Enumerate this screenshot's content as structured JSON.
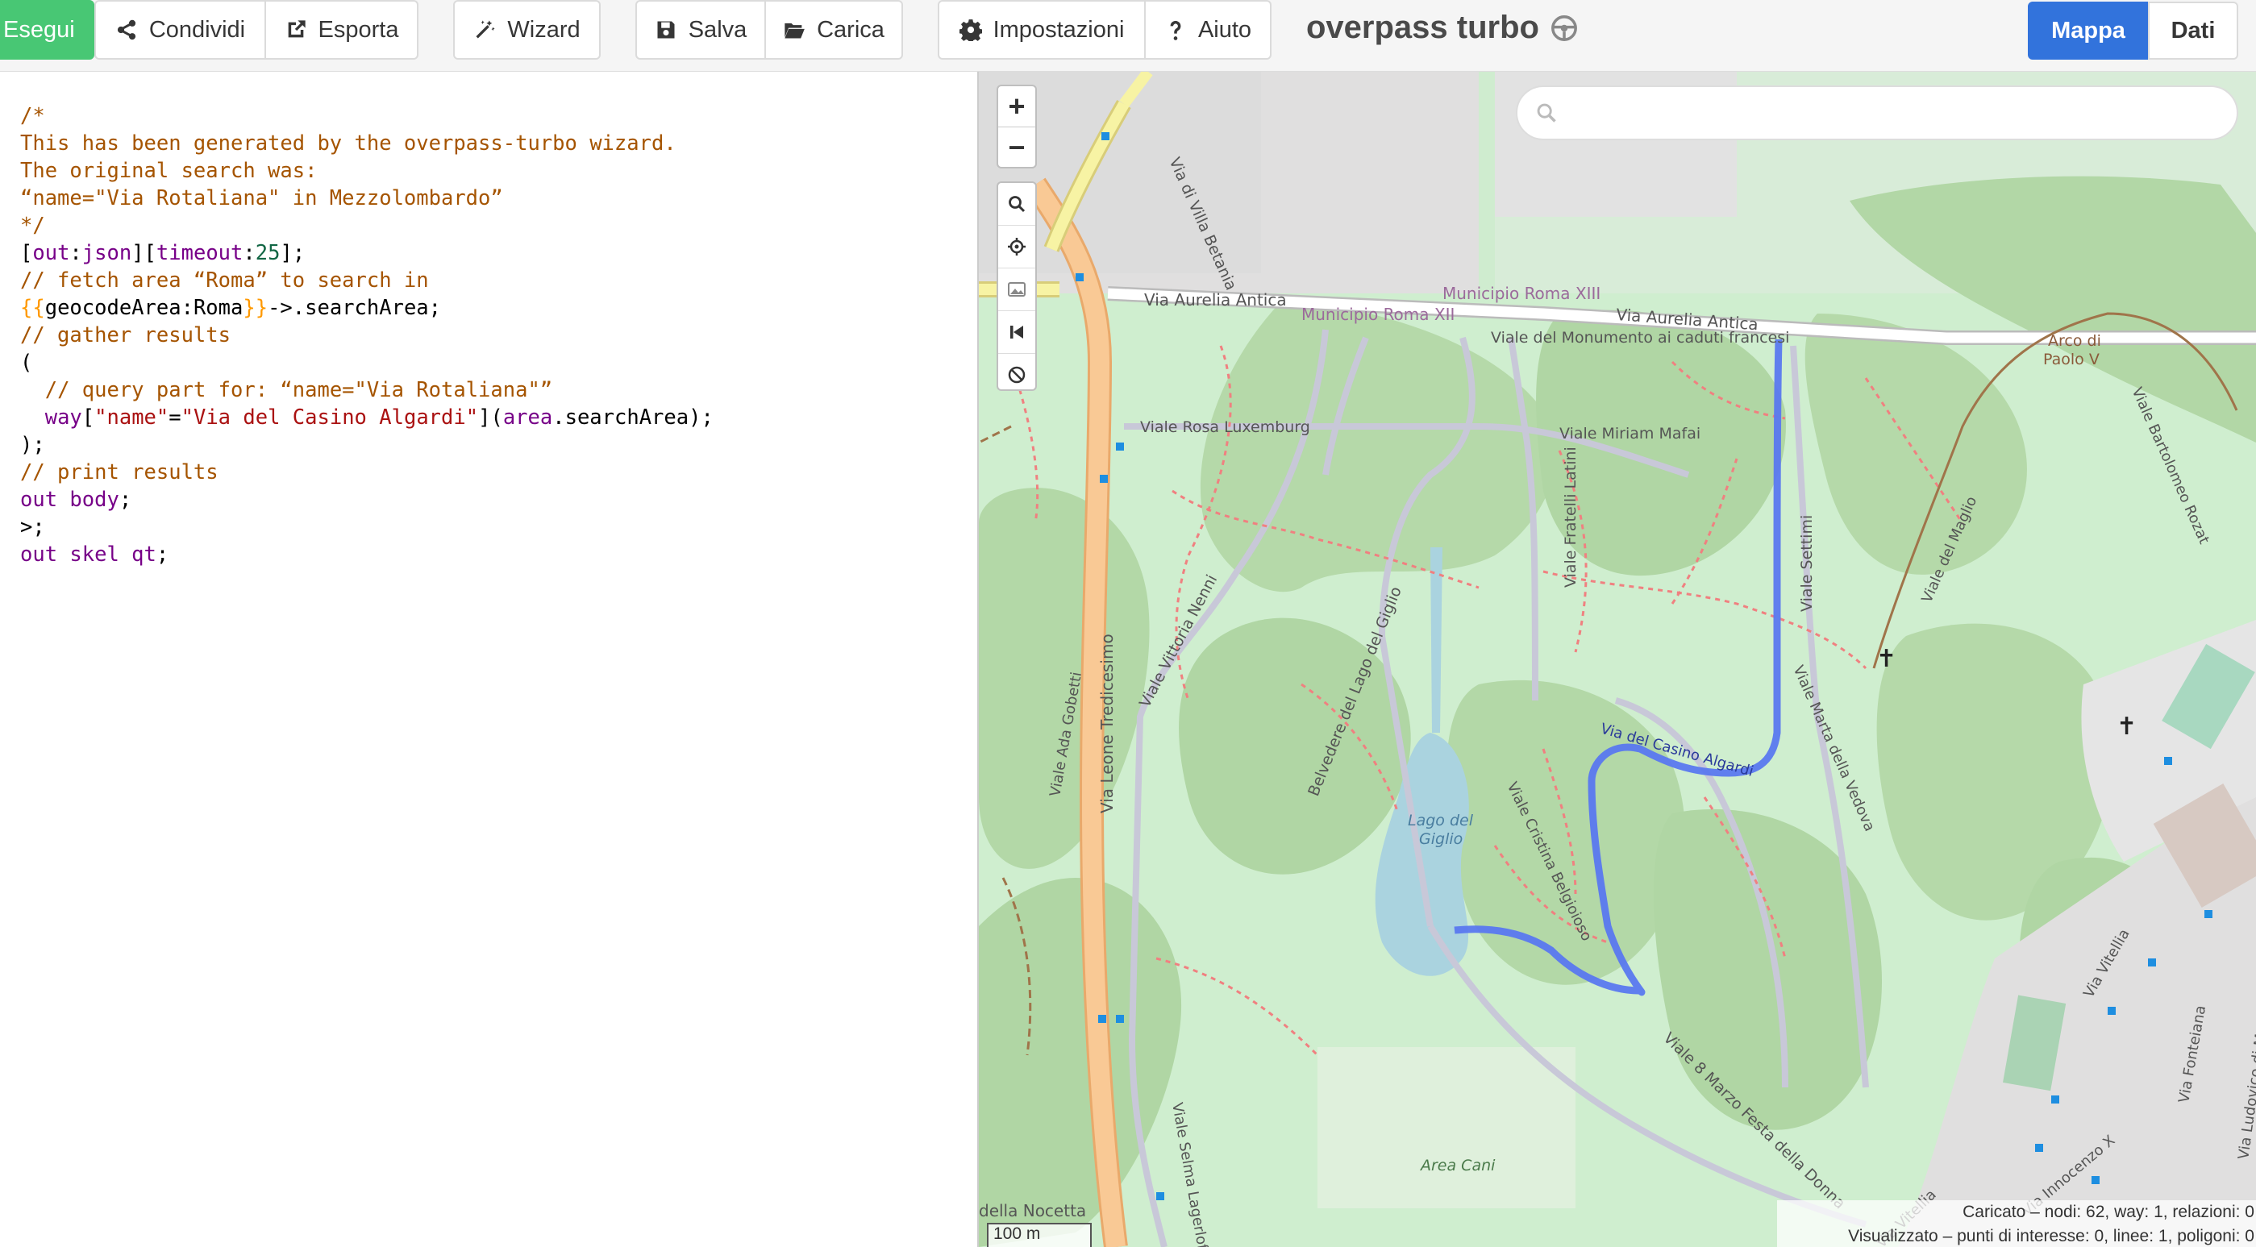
{
  "toolbar": {
    "run": "Esegui",
    "share": "Condividi",
    "export": "Esporta",
    "wizard": "Wizard",
    "save": "Salva",
    "load": "Carica",
    "settings": "Impostazioni",
    "help": "Aiuto",
    "app_title": "overpass turbo",
    "map_tab": "Mappa",
    "data_tab": "Dati"
  },
  "editor": {
    "lines": {
      "l1": "/*",
      "l2": "This has been generated by the overpass-turbo wizard.",
      "l3": "The original search was:",
      "l4": "“name=\"Via Rotaliana\" in Mezzolombardo”",
      "l5": "*/",
      "l6_kw1": "out",
      "l6_kw2": "json",
      "l6_kw3": "timeout",
      "l6_num": "25",
      "l7": "// fetch area “Roma” to search in",
      "l8_tpl_open": "{{",
      "l8_mid": "geocodeArea:Roma",
      "l8_tpl_close": "}}",
      "l8_rest": "->.searchArea;",
      "l9": "// gather results",
      "l11": "// query part for: “name=\"Via Rotaliana\"”",
      "l12_kw": "way",
      "l12_k": "\"name\"",
      "l12_v": "\"Via del Casino Algardi\"",
      "l12_area": "area",
      "l12_rest": ".searchArea);",
      "l14": "// print results",
      "l15_kw": "out body",
      "l16": ">;",
      "l17_kw": "out skel qt"
    }
  },
  "map": {
    "search_placeholder": "",
    "scale_label": "100 m",
    "stats_loaded": "Caricato – nodi: 62, way: 1, relazioni: 0",
    "stats_shown": "Visualizzato – punti di interesse: 0, linee: 1, poligoni: 0",
    "labels": {
      "via_aurelia_antica_1": "Via Aurelia Antica",
      "via_aurelia_antica_2": "Via Aurelia Antica",
      "municipio_xiii": "Municipio Roma XIII",
      "municipio_xii": "Municipio Roma XII",
      "viale_monumento": "Viale del Monumento ai caduti francesi",
      "via_villa_betania": "Via di Villa Betania",
      "viale_rosa": "Viale Rosa Luxemburg",
      "viale_miriam": "Viale Miriam Mafai",
      "viale_fratelli": "Viale Fratelli Latini",
      "viale_settimi": "Viale Settimi",
      "viale_vittoria": "Viale Vittoria Nenni",
      "via_leone": "Via Leone Tredicesimo",
      "viale_ada": "Viale Ada Gobetti",
      "belvedere": "Belvedere del Lago del Giglio",
      "lago_1": "Lago del",
      "lago_2": "Giglio",
      "viale_cristina": "Viale Cristina Belgioioso",
      "via_casino": "Via del Casino Algardi",
      "viale_marta": "Viale Marta della Vedova",
      "viale_8_marzo": "Viale 8 Marzo Festa della Donna",
      "area_cani": "Area Cani",
      "viale_selma": "Viale Selma Lagerlof",
      "della_nocetta": "della Nocetta",
      "arco_1": "Arco di",
      "arco_2": "Paolo V",
      "viale_bartolomeo": "Viale Bartolomeo Rozat",
      "viale_maglio": "Viale del Maglio",
      "via_vitellia_1": "Via Vitellia",
      "via_vitellia_2": "Via Vitellia",
      "via_innocenzo": "Via Innocenzo X",
      "via_fonteiana": "Via Fonteiana",
      "via_ludovico": "Via Ludovico di Monreale"
    }
  },
  "colors": {
    "run_green": "#48c774",
    "active_blue": "#3273dc",
    "highlight_way": "#5a78ef",
    "park_green": "#cdebce",
    "wood_green": "#add19e",
    "motorway_orange": "#f9c995"
  }
}
